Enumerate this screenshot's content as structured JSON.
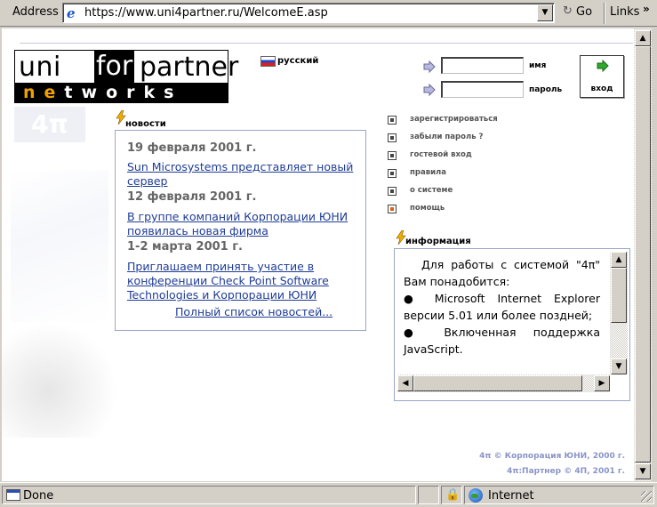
{
  "browser": {
    "address_label": "Address",
    "url": "https://www.uni4partner.ru/WelcomeE.asp",
    "go_label": "Go",
    "links_label": "Links",
    "status_text": "Done",
    "zone_text": "Internet"
  },
  "logo": {
    "word1": "uni",
    "word2": "for",
    "word3": "partner",
    "net_letters": [
      "n",
      "e",
      "t",
      "w",
      "o",
      "r",
      "k",
      "s"
    ],
    "watermark": "4π"
  },
  "language": {
    "label": "русский"
  },
  "login": {
    "name_label": "имя",
    "password_label": "пароль",
    "submit_label": "вход"
  },
  "news": {
    "header": "новости",
    "items": [
      {
        "date": "19 февраля 2001 г.",
        "text": "Sun Microsystems представляет новый сервер"
      },
      {
        "date": "12 февраля 2001 г.",
        "text": "В группе компаний Корпорации ЮНИ появилась новая фирма"
      },
      {
        "date": "1-2 марта 2001 г.",
        "text": "Приглашаем принять участие в конференции Check Point Software Technologies и Корпорации ЮНИ"
      }
    ],
    "all_link": "Полный список новостей..."
  },
  "menu": {
    "items": [
      {
        "label": "зарегистрироваться",
        "active": false
      },
      {
        "label": "забыли пароль ?",
        "active": false
      },
      {
        "label": "гостевой вход",
        "active": false
      },
      {
        "label": "правила",
        "active": false
      },
      {
        "label": "о системе",
        "active": false
      },
      {
        "label": "помощь",
        "active": true
      }
    ]
  },
  "info": {
    "header": "информация",
    "intro": "Для работы с системой \"4π\" Вам понадобится:",
    "bullets": [
      "Microsoft Internet Explorer версии 5.01 или более поздней;",
      "Включенная поддержка JavaScript."
    ]
  },
  "footer": {
    "line1": "4π © Корпорация ЮНИ, 2000 г.",
    "line2": "4π:Партнер © 4П, 2001 г."
  },
  "colors": {
    "link": "#1e3c96",
    "box_border": "#9aa6c6",
    "footer": "#8a94c8",
    "logo_accent": "#f0a000"
  }
}
